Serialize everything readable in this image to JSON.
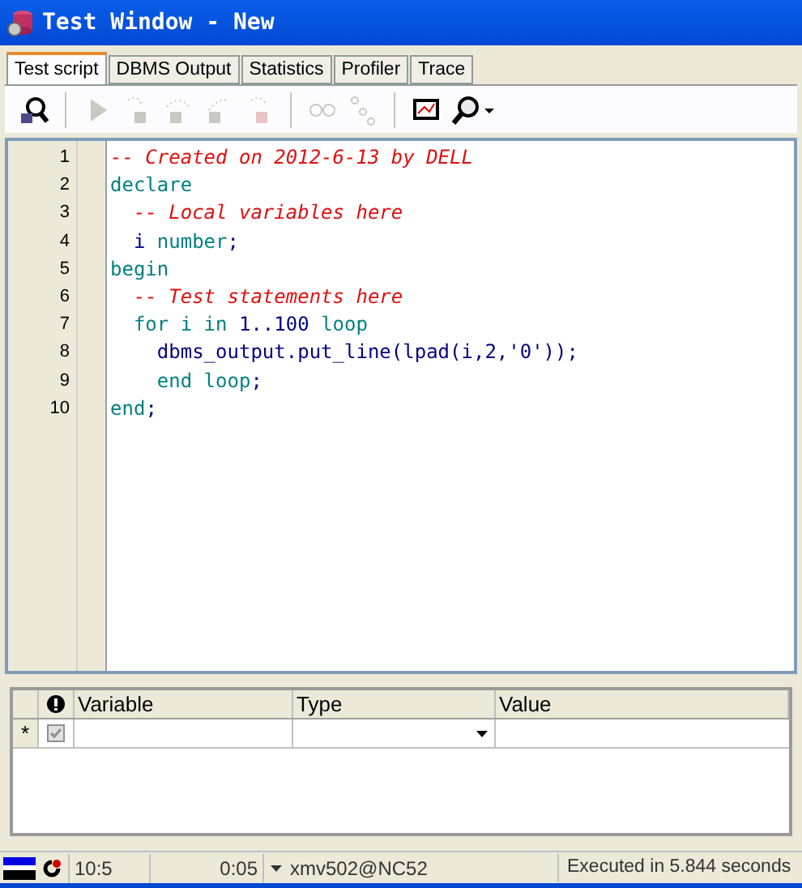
{
  "window": {
    "title": "Test Window - New"
  },
  "tabs": [
    {
      "label": "Test script",
      "selected": true
    },
    {
      "label": "DBMS Output",
      "selected": false
    },
    {
      "label": "Statistics",
      "selected": false
    },
    {
      "label": "Profiler",
      "selected": false
    },
    {
      "label": "Trace",
      "selected": false
    }
  ],
  "toolbar": [
    {
      "kind": "debug",
      "disabled": false
    },
    {
      "kind": "sep"
    },
    {
      "kind": "run",
      "disabled": true
    },
    {
      "kind": "step-into",
      "disabled": true
    },
    {
      "kind": "step-over",
      "disabled": true
    },
    {
      "kind": "step-out",
      "disabled": true
    },
    {
      "kind": "stop",
      "disabled": true
    },
    {
      "kind": "sep"
    },
    {
      "kind": "watch",
      "disabled": true
    },
    {
      "kind": "vars",
      "disabled": true
    },
    {
      "kind": "sep"
    },
    {
      "kind": "screen",
      "disabled": false
    },
    {
      "kind": "find",
      "disabled": false
    }
  ],
  "code": {
    "lines": [
      {
        "number": "1",
        "tokens": [
          {
            "kind": "comment",
            "text": "-- Created on 2012-6-13 by DELL"
          }
        ]
      },
      {
        "number": "2",
        "tokens": [
          {
            "kind": "keyword",
            "text": "declare"
          }
        ]
      },
      {
        "number": "3",
        "tokens": [
          {
            "kind": "comment",
            "text": "  -- Local variables here"
          }
        ]
      },
      {
        "number": "4",
        "tokens": [
          {
            "kind": "plain",
            "text": "  i "
          },
          {
            "kind": "keyword",
            "text": "number"
          },
          {
            "kind": "plain",
            "text": ";"
          }
        ]
      },
      {
        "number": "5",
        "tokens": [
          {
            "kind": "keyword",
            "text": "begin"
          }
        ]
      },
      {
        "number": "6",
        "tokens": [
          {
            "kind": "comment",
            "text": "  -- Test statements here"
          }
        ]
      },
      {
        "number": "7",
        "tokens": [
          {
            "kind": "keyword",
            "text": "  for i in "
          },
          {
            "kind": "plain",
            "text": "1..100"
          },
          {
            "kind": "keyword",
            "text": " loop"
          }
        ]
      },
      {
        "number": "8",
        "tokens": [
          {
            "kind": "plain",
            "text": "    dbms_output.put_line(lpad(i,2,'0'));"
          }
        ]
      },
      {
        "number": "9",
        "tokens": [
          {
            "kind": "keyword",
            "text": "    end loop"
          },
          {
            "kind": "plain",
            "text": ";"
          }
        ]
      },
      {
        "number": "10",
        "tokens": [
          {
            "kind": "keyword",
            "text": "end"
          },
          {
            "kind": "plain",
            "text": ";"
          }
        ]
      }
    ]
  },
  "variables": {
    "columns": [
      "Variable",
      "Type",
      "Value"
    ],
    "new_row": {
      "marker": "*",
      "checked": true
    }
  },
  "status_bar": {
    "position": "10:5",
    "elapsed": "0:05",
    "connection": "xmv502@NC52",
    "message": "Executed in 5.844 seconds"
  }
}
